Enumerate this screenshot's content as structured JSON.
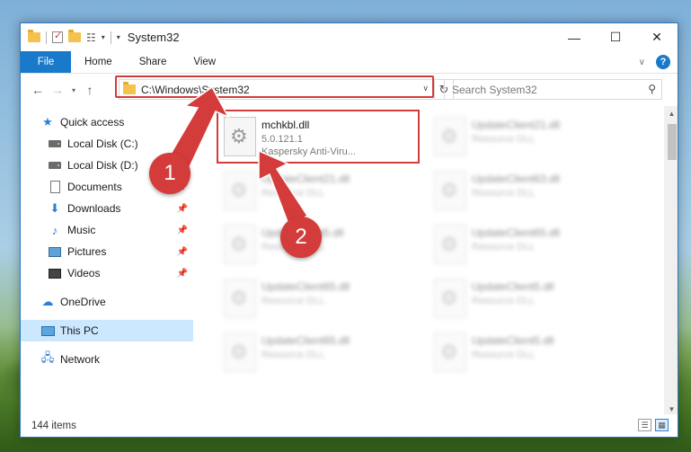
{
  "window": {
    "title": "System32",
    "controls": {
      "minimize": "—",
      "maximize": "☐",
      "close": "✕"
    }
  },
  "ribbon": {
    "tabs": [
      "File",
      "Home",
      "Share",
      "View"
    ]
  },
  "address": {
    "path": "C:\\Windows\\System32",
    "search_placeholder": "Search System32"
  },
  "sidebar": {
    "items": [
      {
        "label": "Quick access",
        "icon": "star-icon"
      },
      {
        "label": "Local Disk (C:)",
        "icon": "disk-icon"
      },
      {
        "label": "Local Disk (D:)",
        "icon": "disk-icon"
      },
      {
        "label": "Documents",
        "icon": "documents-icon"
      },
      {
        "label": "Downloads",
        "icon": "downloads-icon"
      },
      {
        "label": "Music",
        "icon": "music-icon"
      },
      {
        "label": "Pictures",
        "icon": "pictures-icon"
      },
      {
        "label": "Videos",
        "icon": "videos-icon"
      },
      {
        "label": "OneDrive",
        "icon": "onedrive-icon"
      },
      {
        "label": "This PC",
        "icon": "this-pc-icon"
      },
      {
        "label": "Network",
        "icon": "network-icon"
      }
    ]
  },
  "files": [
    {
      "name": "mchkbl.dll",
      "line2": "5.0.121.1",
      "line3": "Kaspersky Anti-Viru..."
    },
    {
      "name": "UpdateClient21.dll",
      "line2": "Resource DLL"
    },
    {
      "name": "UpdateClient21.dll",
      "line2": "Resource DLL"
    },
    {
      "name": "UpdateClient63.dll",
      "line2": "Resource DLL"
    },
    {
      "name": "UpdateClient5.dll",
      "line2": "Resource DLL"
    },
    {
      "name": "UpdateClient65.dll",
      "line2": "Resource DLL"
    },
    {
      "name": "UpdateClient65.dll",
      "line2": "Resource DLL"
    },
    {
      "name": "UpdateClient5.dll",
      "line2": "Resource DLL"
    },
    {
      "name": "UpdateClient65.dll",
      "line2": "Resource DLL"
    },
    {
      "name": "UpdateClient5.dll",
      "line2": "Resource DLL"
    }
  ],
  "status": {
    "item_count": "144 items"
  },
  "callouts": [
    "1",
    "2"
  ],
  "colors": {
    "accent": "#1979ca",
    "highlight": "#d43b3b",
    "selected": "#cce8ff"
  }
}
